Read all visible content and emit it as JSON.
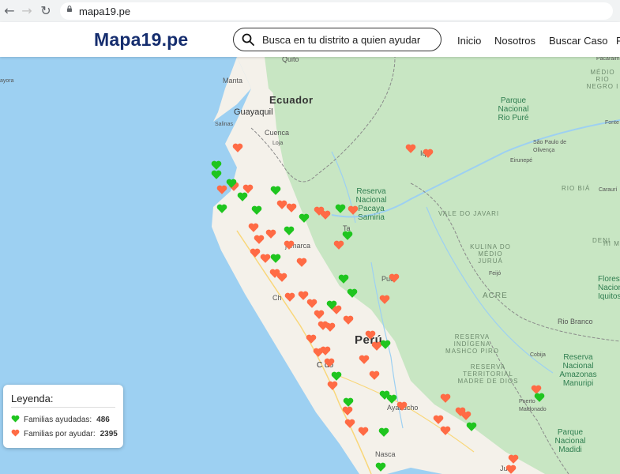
{
  "browser": {
    "url": "mapa19.pe"
  },
  "header": {
    "logo": "Mapa19.pe",
    "search": {
      "placeholder": "Busca en tu distrito a quien ayudar"
    },
    "nav": [
      "Inicio",
      "Nosotros",
      "Buscar Caso",
      "F"
    ]
  },
  "map": {
    "country_labels": {
      "ecuador": "Ecuador",
      "peru": "Perú"
    },
    "city_labels": {
      "quito": "Quito",
      "manta": "Manta",
      "guayaquil": "Guayaquil",
      "cuenca": "Cuenca",
      "salinas": "Salinas",
      "ayora": "ayora",
      "loja": "Loja",
      "iquitos": "Iq",
      "tarapoto": "Ta",
      "cajamarca": "jamarca",
      "chimbote": "Ch",
      "pucallpa": "Puc",
      "lima": "C do",
      "ayacucho": "Ayacucho",
      "nasca": "Nasca",
      "puerto_maldonado": "Puerto Maldonado",
      "juliaca": "Ju",
      "cobija": "Cobija",
      "rio_branco": "Rio Branco",
      "feijo": "Feijó",
      "sao_paulo": "São Paulo de Olivença",
      "caruari": "Caraurí",
      "fonte": "Fonte",
      "eirunepe": "Eirunepé",
      "pacaraima": "Pacaraima"
    },
    "parks": {
      "rio_pure": "Parque Nacional Rio Puré",
      "samiria": "Reserva Nacional Pacaya Samiria",
      "iquitos_res": "Floresta Nacional do Iquitos",
      "amazonas": "Reserva Nacional Amazonas Manuripi",
      "madidi": "Parque Nacional Madidi"
    },
    "regions": {
      "rio_negro": "MÉDIO RIO NEGRO I",
      "vale_javari": "VALE DO JAVARI",
      "kulina": "KULINA DO MÉDIO JURUÁ",
      "deni": "DENI",
      "rio_bia": "RIO BIÁ",
      "acre": "ACRE",
      "mashco": "RESERVA INDÍGENA MASHCO PIRO",
      "madre_dios": "RESERVA TERRITORIAL MADRE DE DIOS",
      "hi_m": "HI M"
    },
    "colors": {
      "helped": "#1fc51f",
      "to_help": "#ff6b45",
      "water": "#9dd0f2",
      "land": "#f4f1ea",
      "forest": "#c8e6c3"
    },
    "markers_helped": [
      [
        274,
        209
      ],
      [
        274,
        221
      ],
      [
        293,
        232
      ],
      [
        281,
        264
      ],
      [
        307,
        249
      ],
      [
        349,
        241
      ],
      [
        325,
        266
      ],
      [
        385,
        276
      ],
      [
        431,
        264
      ],
      [
        366,
        292
      ],
      [
        440,
        298
      ],
      [
        349,
        327
      ],
      [
        435,
        353
      ],
      [
        446,
        371
      ],
      [
        420,
        386
      ],
      [
        488,
        436
      ],
      [
        426,
        476
      ],
      [
        487,
        500
      ],
      [
        496,
        505
      ],
      [
        441,
        509
      ],
      [
        486,
        547
      ],
      [
        597,
        540
      ],
      [
        683,
        503
      ],
      [
        482,
        591
      ]
    ],
    "markers_to_help": [
      [
        301,
        187
      ],
      [
        520,
        188
      ],
      [
        542,
        194
      ],
      [
        281,
        240
      ],
      [
        296,
        236
      ],
      [
        314,
        239
      ],
      [
        357,
        259
      ],
      [
        369,
        263
      ],
      [
        404,
        267
      ],
      [
        412,
        272
      ],
      [
        447,
        266
      ],
      [
        343,
        296
      ],
      [
        321,
        288
      ],
      [
        328,
        303
      ],
      [
        366,
        310
      ],
      [
        429,
        310
      ],
      [
        336,
        327
      ],
      [
        382,
        332
      ],
      [
        357,
        351
      ],
      [
        499,
        352
      ],
      [
        367,
        376
      ],
      [
        384,
        374
      ],
      [
        395,
        384
      ],
      [
        487,
        379
      ],
      [
        404,
        398
      ],
      [
        441,
        405
      ],
      [
        426,
        392
      ],
      [
        394,
        429
      ],
      [
        469,
        424
      ],
      [
        477,
        438
      ],
      [
        409,
        412
      ],
      [
        412,
        444
      ],
      [
        403,
        446
      ],
      [
        417,
        459
      ],
      [
        461,
        455
      ],
      [
        474,
        475
      ],
      [
        421,
        488
      ],
      [
        440,
        520
      ],
      [
        443,
        536
      ],
      [
        460,
        546
      ],
      [
        509,
        514
      ],
      [
        564,
        504
      ],
      [
        555,
        531
      ],
      [
        583,
        521
      ],
      [
        590,
        526
      ],
      [
        564,
        545
      ],
      [
        679,
        493
      ],
      [
        650,
        581
      ],
      [
        647,
        594
      ],
      [
        348,
        346
      ],
      [
        323,
        320
      ],
      [
        418,
        414
      ]
    ]
  },
  "legend": {
    "title": "Leyenda:",
    "helped_label": "Familias ayudadas:",
    "helped_count": "486",
    "to_help_label": "Familias por ayudar:",
    "to_help_count": "2395"
  }
}
